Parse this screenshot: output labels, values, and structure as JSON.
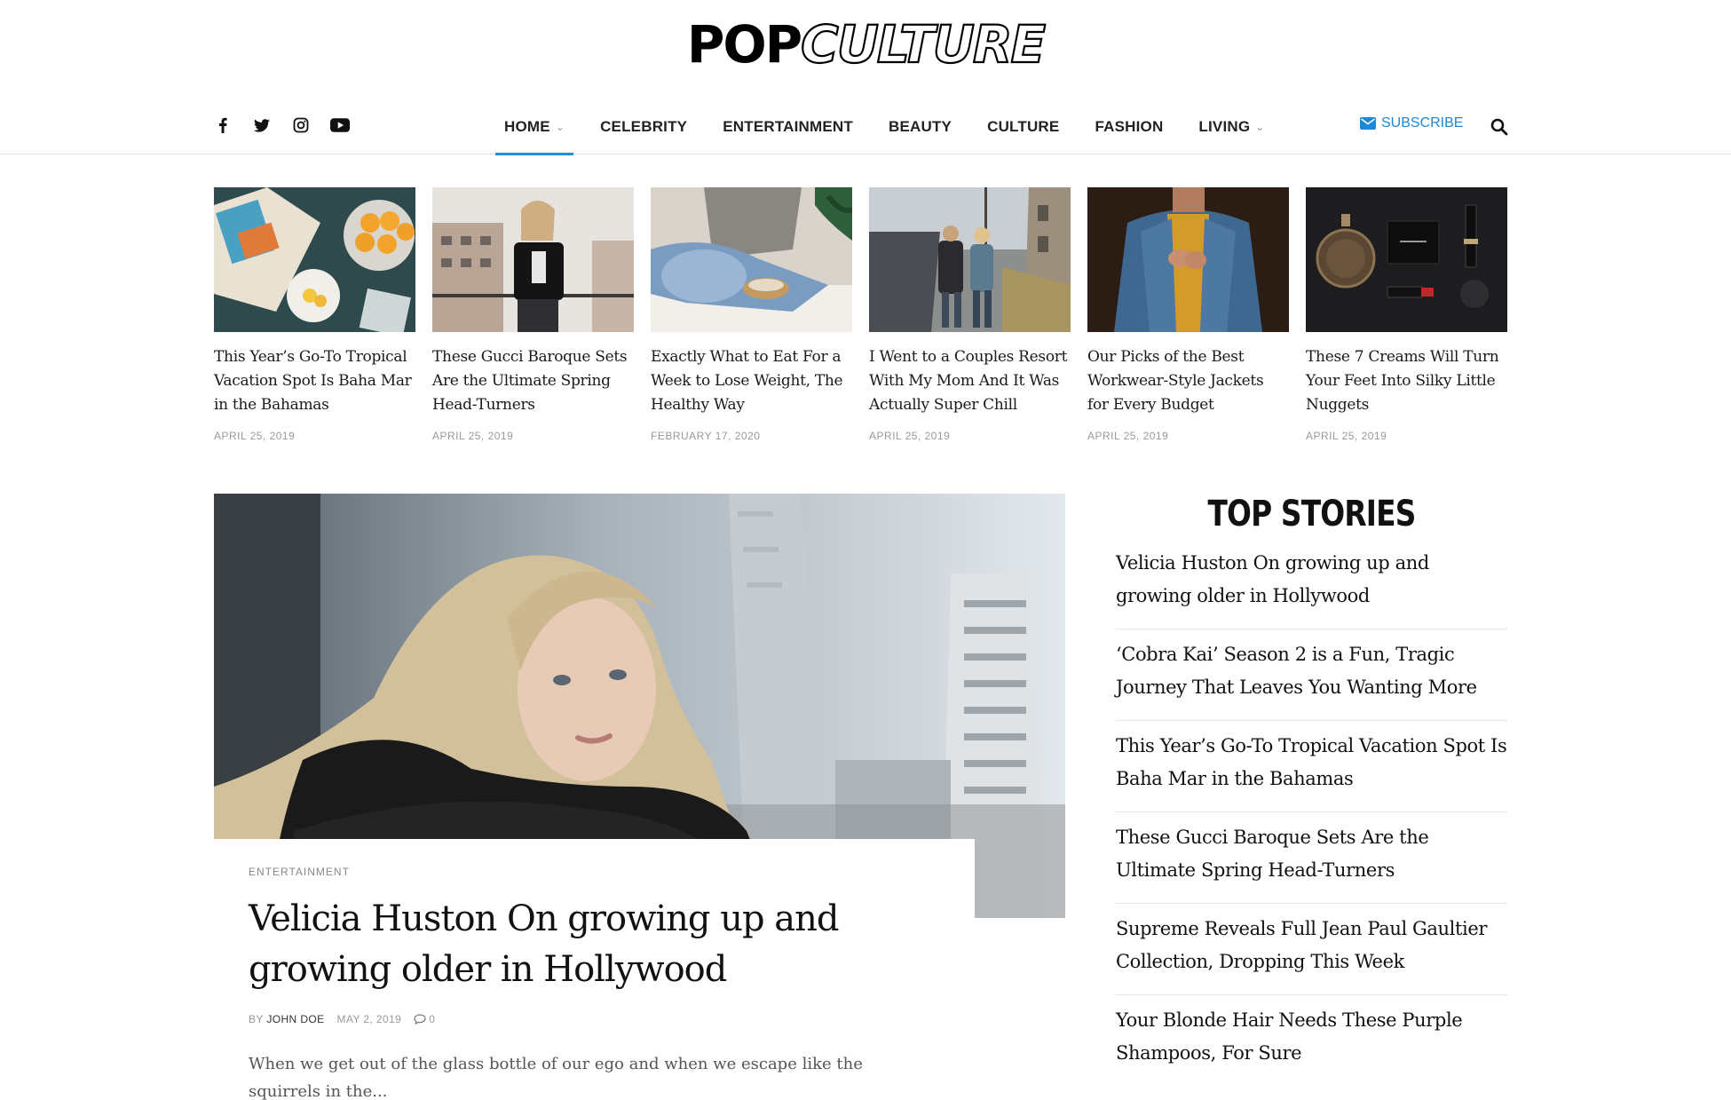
{
  "logo": {
    "pop": "POP",
    "culture": "CULTURE"
  },
  "nav": {
    "menu": [
      {
        "label": "HOME",
        "has_dropdown": true,
        "active": true
      },
      {
        "label": "CELEBRITY",
        "has_dropdown": false
      },
      {
        "label": "ENTERTAINMENT",
        "has_dropdown": false
      },
      {
        "label": "BEAUTY",
        "has_dropdown": false
      },
      {
        "label": "CULTURE",
        "has_dropdown": false
      },
      {
        "label": "FASHION",
        "has_dropdown": false
      },
      {
        "label": "LIVING",
        "has_dropdown": true
      }
    ],
    "subscribe_label": "SUBSCRIBE",
    "social_icons": [
      "facebook-icon",
      "twitter-icon",
      "instagram-icon",
      "youtube-icon"
    ]
  },
  "thumbnails": [
    {
      "title": "This Year’s Go-To Tropical Vacation Spot Is Baha Mar in the Bahamas",
      "date": "APRIL 25, 2019"
    },
    {
      "title": "These Gucci Baroque Sets Are the Ultimate Spring Head-Turners",
      "date": "APRIL 25, 2019"
    },
    {
      "title": "Exactly What to Eat For a Week to Lose Weight, The Healthy Way",
      "date": "FEBRUARY 17, 2020"
    },
    {
      "title": "I Went to a Couples Resort With My Mom And It Was Actually Super Chill",
      "date": "APRIL 25, 2019"
    },
    {
      "title": "Our Picks of the Best Workwear-Style Jackets for Every Budget",
      "date": "APRIL 25, 2019"
    },
    {
      "title": "These 7 Creams Will Turn Your Feet Into Silky Little Nuggets",
      "date": "APRIL 25, 2019"
    }
  ],
  "featured": {
    "category": "ENTERTAINMENT",
    "title": "Velicia Huston On growing up and growing older in Hollywood",
    "by": "BY",
    "author": "JOHN DOE",
    "date": "MAY 2, 2019",
    "comments": "0",
    "excerpt": "When we get out of the glass bottle of our ego and when we escape like the squirrels in the..."
  },
  "top_stories": {
    "heading": "TOP STORIES",
    "items": [
      "Velicia Huston On growing up and growing older in Hollywood",
      "‘Cobra Kai’ Season 2 is a Fun, Tragic Journey That Leaves You Wanting More",
      "This Year’s Go-To Tropical Vacation Spot Is Baha Mar in the Bahamas",
      "These Gucci Baroque Sets Are the Ultimate Spring Head-Turners",
      "Supreme Reveals Full Jean Paul Gaultier Collection, Dropping This Week",
      "Your Blonde Hair Needs These Purple Shampoos, For Sure"
    ]
  },
  "colors": {
    "accent": "#1e90e0",
    "text": "#111111",
    "muted": "#999999"
  }
}
